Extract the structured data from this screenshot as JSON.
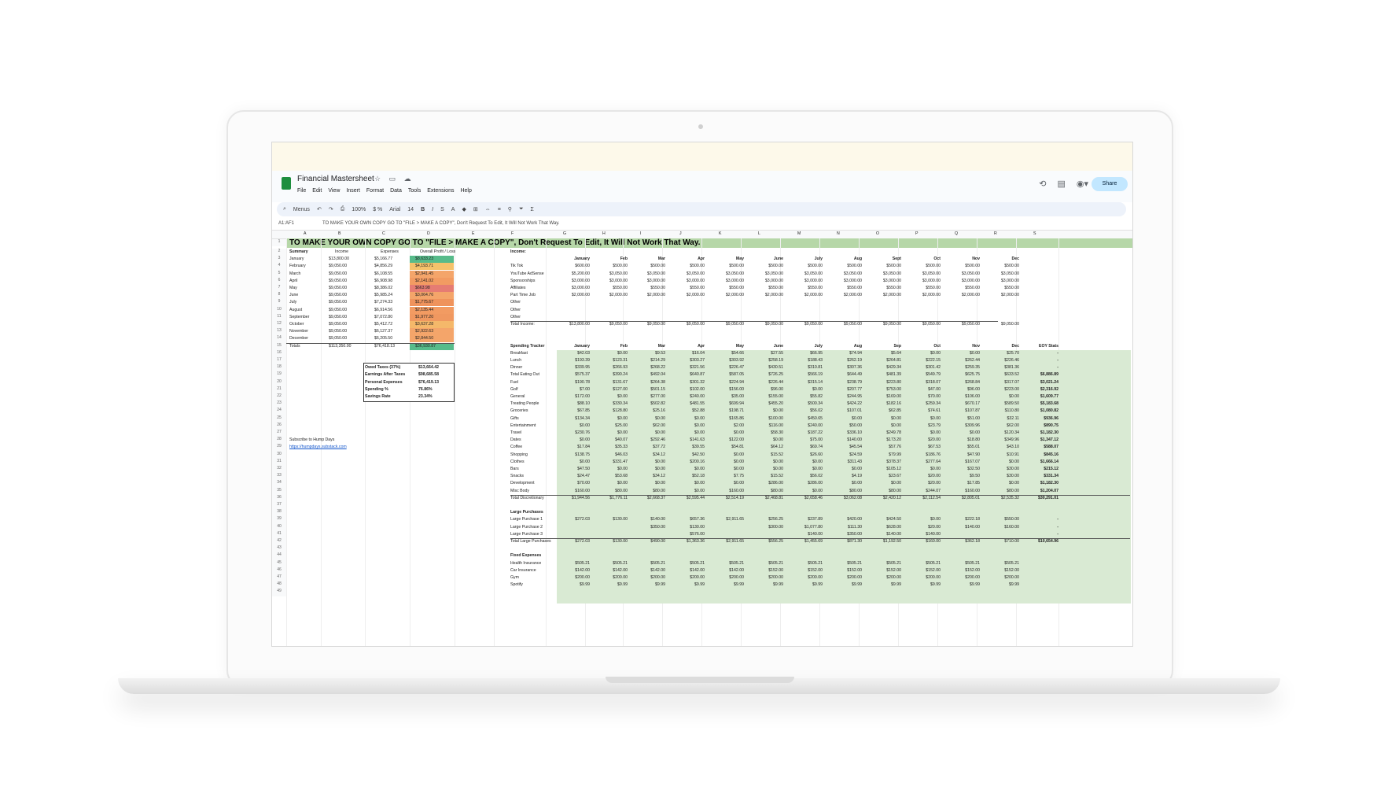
{
  "sheet": {
    "title": "Financial Mastersheet",
    "menu": [
      "File",
      "Edit",
      "View",
      "Insert",
      "Format",
      "Data",
      "Tools",
      "Extensions",
      "Help"
    ],
    "share_label": "Share",
    "toolbar": {
      "menus": "Menus",
      "zoom": "100%",
      "font": "Arial",
      "font_size": "14"
    },
    "namebox": "A1:AF1",
    "formula": "TO MAKE YOUR OWN COPY GO TO \"FILE > MAKE A COPY\", Don't Request To Edit, It Will Not Work That Way.",
    "columns": [
      "A",
      "B",
      "C",
      "D",
      "E",
      "F",
      "G",
      "H",
      "I",
      "J",
      "K",
      "L",
      "M",
      "N",
      "O",
      "P",
      "Q",
      "R",
      "S"
    ],
    "banner": "TO MAKE YOUR OWN COPY GO TO \"FILE > MAKE A COPY\", Don't Request To Edit, It Will Not Work That Way."
  },
  "summary": {
    "headers": [
      "Summary",
      "Income",
      "Expenses",
      "Overall Profit / Loss"
    ],
    "rows": [
      {
        "m": "January",
        "i": "$13,800.00",
        "e": "$5,166.77",
        "p": "$8,633.23",
        "c": "#57bb8a"
      },
      {
        "m": "February",
        "i": "$9,050.00",
        "e": "$4,856.29",
        "p": "$4,193.71",
        "c": "#f5c26b"
      },
      {
        "m": "March",
        "i": "$9,050.00",
        "e": "$6,108.55",
        "p": "$2,941.45",
        "c": "#f4a56a"
      },
      {
        "m": "April",
        "i": "$9,050.00",
        "e": "$6,908.98",
        "p": "$2,141.02",
        "c": "#f29b62"
      },
      {
        "m": "May",
        "i": "$9,050.00",
        "e": "$8,386.02",
        "p": "$663.98",
        "c": "#e67c73"
      },
      {
        "m": "June",
        "i": "$9,050.00",
        "e": "$5,985.24",
        "p": "$3,064.76",
        "c": "#f4a56a"
      },
      {
        "m": "July",
        "i": "$9,050.00",
        "e": "$7,274.33",
        "p": "$1,775.67",
        "c": "#ef935c"
      },
      {
        "m": "August",
        "i": "$9,050.00",
        "e": "$6,914.56",
        "p": "$2,135.44",
        "c": "#f29b62"
      },
      {
        "m": "September",
        "i": "$9,050.00",
        "e": "$7,072.80",
        "p": "$1,977.20",
        "c": "#f09860"
      },
      {
        "m": "October",
        "i": "$9,050.00",
        "e": "$5,412.72",
        "p": "$3,637.28",
        "c": "#f5b86a"
      },
      {
        "m": "November",
        "i": "$9,050.00",
        "e": "$6,127.37",
        "p": "$2,922.63",
        "c": "#f4a56a"
      },
      {
        "m": "December",
        "i": "$9,050.00",
        "e": "$6,205.50",
        "p": "$2,844.50",
        "c": "#f4a56a"
      },
      {
        "m": "Totals",
        "i": "$113,350.00",
        "e": "$76,418.13",
        "p": "$36,930.87",
        "c": "#57bb8a"
      }
    ]
  },
  "stats": [
    {
      "label": "Owed Taxes (37%)",
      "value": "$13,664.42"
    },
    {
      "label": "Earnings After Taxes",
      "value": "$98,685.58"
    },
    {
      "label": "Personal Expenses",
      "value": "$76,419.13"
    },
    {
      "label": "Spending %",
      "value": "76.86%"
    },
    {
      "label": "Savings Rate",
      "value": "23.34%"
    }
  ],
  "subscribe": {
    "text": "Subscribe to Hump Days",
    "link": "https://humpdays.substack.com"
  },
  "income": {
    "title": "Income:",
    "months": [
      "January",
      "Feb",
      "Mar",
      "Apr",
      "May",
      "June",
      "July",
      "Aug",
      "Sept",
      "Oct",
      "Nov",
      "Dec"
    ],
    "rows": [
      {
        "label": "Tik Tok",
        "vals": [
          "$600.00",
          "$500.00",
          "$500.00",
          "$500.00",
          "$500.00",
          "$500.00",
          "$500.00",
          "$500.00",
          "$500.00",
          "$500.00",
          "$500.00",
          "$500.00"
        ]
      },
      {
        "label": "YouTube AdSense",
        "vals": [
          "$5,200.00",
          "$3,050.00",
          "$3,050.00",
          "$3,050.00",
          "$3,050.00",
          "$3,050.00",
          "$3,050.00",
          "$3,050.00",
          "$3,050.00",
          "$3,050.00",
          "$3,050.00",
          "$3,050.00"
        ]
      },
      {
        "label": "Sponsorships",
        "vals": [
          "$3,000.00",
          "$3,000.00",
          "$3,000.00",
          "$3,000.00",
          "$3,000.00",
          "$3,000.00",
          "$3,000.00",
          "$3,000.00",
          "$3,000.00",
          "$3,000.00",
          "$3,000.00",
          "$3,000.00"
        ]
      },
      {
        "label": "Affiliates",
        "vals": [
          "$3,000.00",
          "$550.00",
          "$550.00",
          "$550.00",
          "$550.00",
          "$550.00",
          "$550.00",
          "$550.00",
          "$550.00",
          "$550.00",
          "$550.00",
          "$550.00"
        ]
      },
      {
        "label": "Part Time Job",
        "vals": [
          "$2,000.00",
          "$2,000.00",
          "$2,000.00",
          "$2,000.00",
          "$2,000.00",
          "$2,000.00",
          "$2,000.00",
          "$2,000.00",
          "$2,000.00",
          "$2,000.00",
          "$2,000.00",
          "$2,000.00"
        ]
      },
      {
        "label": "Other",
        "vals": []
      },
      {
        "label": "Other",
        "vals": []
      },
      {
        "label": "Other",
        "vals": []
      }
    ],
    "total_label": "Total Income:",
    "totals": [
      "$13,800.00",
      "$9,050.00",
      "$9,050.00",
      "$9,050.00",
      "$9,050.00",
      "$9,050.00",
      "$9,050.00",
      "$9,050.00",
      "$9,050.00",
      "$9,050.00",
      "$9,050.00",
      "$9,050.00"
    ]
  },
  "spending": {
    "title": "Spending Tracker",
    "months": [
      "January",
      "Feb",
      "Mar",
      "Apr",
      "May",
      "June",
      "July",
      "Aug",
      "Sep",
      "Oct",
      "Nov",
      "Dec",
      "EOY Stats"
    ],
    "rows": [
      {
        "label": "Breakfast",
        "vals": [
          "$42.03",
          "$0.00",
          "$9.53",
          "$16.04",
          "$54.66",
          "$27.55",
          "$66.95",
          "$74.94",
          "$5.64",
          "$0.00",
          "$0.00",
          "$25.70",
          "-"
        ]
      },
      {
        "label": "Lunch",
        "vals": [
          "$193.39",
          "$123.31",
          "$214.29",
          "$303.27",
          "$303.92",
          "$258.19",
          "$188.43",
          "$262.19",
          "$264.81",
          "$222.15",
          "$262.44",
          "$226.46",
          "-"
        ]
      },
      {
        "label": "Dinner",
        "vals": [
          "$339.95",
          "$266.93",
          "$268.22",
          "$321.56",
          "$226.47",
          "$430.51",
          "$310.81",
          "$307.36",
          "$429.34",
          "$301.42",
          "$259.35",
          "$381.36",
          "-"
        ]
      },
      {
        "label": "Total Eating Out",
        "vals": [
          "$575.37",
          "$390.24",
          "$492.04",
          "$640.87",
          "$587.05",
          "$726.25",
          "$566.19",
          "$644.49",
          "$481.39",
          "$549.79",
          "$625.75",
          "$633.52",
          "$6,886.89"
        ]
      },
      {
        "label": "Fuel",
        "vals": [
          "$190.78",
          "$131.67",
          "$264.38",
          "$301.32",
          "$224.94",
          "$226.44",
          "$315.14",
          "$238.79",
          "$223.80",
          "$318.07",
          "$268.84",
          "$317.07",
          "$3,021.24"
        ]
      },
      {
        "label": "Golf",
        "vals": [
          "$7.00",
          "$127.00",
          "$501.15",
          "$102.00",
          "$156.00",
          "$96.00",
          "$0.00",
          "$207.77",
          "$753.00",
          "$47.00",
          "$96.00",
          "$223.00",
          "$2,316.92"
        ]
      },
      {
        "label": "General",
        "vals": [
          "$172.00",
          "$0.00",
          "$277.00",
          "$240.00",
          "$35.00",
          "$155.00",
          "$55.82",
          "$244.95",
          "$169.00",
          "$70.00",
          "$106.00",
          "$0.00",
          "$1,609.77"
        ]
      },
      {
        "label": "Treating People",
        "vals": [
          "$88.10",
          "$330.34",
          "$502.82",
          "$481.55",
          "$699.94",
          "$455.20",
          "$500.34",
          "$424.22",
          "$182.16",
          "$259.34",
          "$670.17",
          "$589.50",
          "$5,183.68"
        ]
      },
      {
        "label": "Groceries",
        "vals": [
          "$67.85",
          "$128.80",
          "$25.16",
          "$52.88",
          "$198.71",
          "$0.00",
          "$56.02",
          "$107.01",
          "$62.85",
          "$74.61",
          "$107.87",
          "$110.80",
          "$1,080.82"
        ]
      },
      {
        "label": "Gifts",
        "vals": [
          "$134.34",
          "$0.00",
          "$0.00",
          "$0.00",
          "$165.86",
          "$100.00",
          "$450.65",
          "$0.00",
          "$0.00",
          "$0.00",
          "$51.00",
          "$32.11",
          "$936.96"
        ]
      },
      {
        "label": "Entertainment",
        "vals": [
          "$0.00",
          "$25.00",
          "$62.00",
          "$0.00",
          "$2.00",
          "$116.00",
          "$240.00",
          "$50.00",
          "$0.00",
          "$23.79",
          "$309.96",
          "$62.00",
          "$890.75"
        ]
      },
      {
        "label": "Travel",
        "vals": [
          "$230.76",
          "$0.00",
          "$0.00",
          "$0.00",
          "$0.00",
          "$58.30",
          "$187.22",
          "$336.10",
          "$249.78",
          "$0.00",
          "$0.00",
          "$120.34",
          "$1,182.30"
        ]
      },
      {
        "label": "Dates",
        "vals": [
          "$0.00",
          "$40.07",
          "$292.46",
          "$141.63",
          "$122.00",
          "$0.00",
          "$75.00",
          "$140.00",
          "$173.20",
          "$20.00",
          "$18.80",
          "$349.96",
          "$1,347.12"
        ]
      },
      {
        "label": "Coffee",
        "vals": [
          "$17.84",
          "$35.33",
          "$37.72",
          "$39.55",
          "$54.81",
          "$64.12",
          "$69.74",
          "$45.54",
          "$57.76",
          "$67.53",
          "$55.01",
          "$43.10",
          "$588.07"
        ]
      },
      {
        "label": "Shopping",
        "vals": [
          "$138.75",
          "$46.03",
          "$34.12",
          "$42.50",
          "$0.00",
          "$15.52",
          "$26.60",
          "$24.59",
          "$79.99",
          "$186.76",
          "$47.90",
          "$10.91",
          "$845.16"
        ]
      },
      {
        "label": "Clothes",
        "vals": [
          "$0.00",
          "$331.47",
          "$0.00",
          "$200.16",
          "$0.00",
          "$0.00",
          "$0.00",
          "$311.43",
          "$378.37",
          "$277.64",
          "$167.07",
          "$0.00",
          "$1,666.14"
        ]
      },
      {
        "label": "Bars",
        "vals": [
          "$47.50",
          "$0.00",
          "$0.00",
          "$0.00",
          "$0.00",
          "$0.00",
          "$0.00",
          "$0.00",
          "$105.12",
          "$0.00",
          "$32.50",
          "$30.00",
          "$215.12"
        ]
      },
      {
        "label": "Snacks",
        "vals": [
          "$24.47",
          "$53.68",
          "$34.12",
          "$52.18",
          "$7.75",
          "$15.52",
          "$56.02",
          "$4.19",
          "$23.67",
          "$20.00",
          "$9.50",
          "$30.00",
          "$331.34"
        ]
      },
      {
        "label": "Development",
        "vals": [
          "$70.00",
          "$0.00",
          "$0.00",
          "$0.00",
          "$0.00",
          "$286.00",
          "$286.00",
          "$0.00",
          "$0.00",
          "$20.00",
          "$17.85",
          "$0.00",
          "$1,182.30"
        ]
      },
      {
        "label": "Misc Body",
        "vals": [
          "$160.00",
          "$80.00",
          "$80.00",
          "$0.00",
          "$160.00",
          "$80.00",
          "$0.00",
          "$80.00",
          "$80.00",
          "$244.07",
          "$160.00",
          "$80.00",
          "$1,204.07"
        ]
      }
    ],
    "total_label": "Total Discretionary",
    "totals": [
      "$1,944.56",
      "$1,776.11",
      "$2,668.37",
      "$2,595.44",
      "$2,514.19",
      "$2,468.81",
      "$2,658.46",
      "$3,062.08",
      "$2,420.12",
      "$2,112.54",
      "$2,805.01",
      "$2,535.32",
      "$30,291.01"
    ]
  },
  "large": {
    "title": "Large Purchases",
    "rows": [
      {
        "label": "Large Purchase 1",
        "vals": [
          "$272.03",
          "$130.00",
          "$140.00",
          "$657.36",
          "$2,911.65",
          "$256.25",
          "$237.89",
          "$420.00",
          "$424.50",
          "$0.00",
          "$222.18",
          "$550.00",
          "-"
        ]
      },
      {
        "label": "Large Purchase 2",
        "vals": [
          "",
          "",
          "$350.00",
          "$130.00",
          "",
          "$300.00",
          "$1,077.80",
          "$111.30",
          "$628.00",
          "$20.00",
          "$140.00",
          "$160.00",
          "-"
        ]
      },
      {
        "label": "Large Purchase 3",
        "vals": [
          "",
          "",
          "",
          "$576.00",
          "",
          "",
          "$140.00",
          "$350.00",
          "$140.00",
          "$140.00",
          "",
          "",
          "-"
        ]
      }
    ],
    "total_label": "Total Large Purchases",
    "totals": [
      "$272.03",
      "$130.00",
      "$490.00",
      "$1,363.36",
      "$2,911.65",
      "$556.25",
      "$1,455.69",
      "$871.30",
      "$1,192.50",
      "$160.00",
      "$362.18",
      "$710.00",
      "$10,654.96"
    ]
  },
  "fixed": {
    "title": "Fixed Expenses",
    "rows": [
      {
        "label": "Health Insurance",
        "vals": [
          "$505.21",
          "$505.21",
          "$505.21",
          "$505.21",
          "$505.21",
          "$505.21",
          "$505.21",
          "$505.21",
          "$505.21",
          "$505.21",
          "$505.21",
          "$505.21",
          ""
        ]
      },
      {
        "label": "Car Insurance",
        "vals": [
          "$142.00",
          "$142.00",
          "$142.00",
          "$142.00",
          "$142.00",
          "$152.00",
          "$152.00",
          "$152.00",
          "$152.00",
          "$152.00",
          "$152.00",
          "$152.00",
          ""
        ]
      },
      {
        "label": "Gym",
        "vals": [
          "$200.00",
          "$200.00",
          "$200.00",
          "$200.00",
          "$200.00",
          "$200.00",
          "$200.00",
          "$200.00",
          "$200.00",
          "$200.00",
          "$200.00",
          "$200.00",
          ""
        ]
      },
      {
        "label": "Spotify",
        "vals": [
          "$9.99",
          "$9.99",
          "$9.99",
          "$9.99",
          "$9.99",
          "$9.99",
          "$9.99",
          "$9.99",
          "$9.99",
          "$9.99",
          "$9.99",
          "$9.99",
          ""
        ]
      }
    ]
  },
  "colors": {
    "banner": "#b6d7a8",
    "green_fill": "#d9ead3",
    "share": "#c2e7ff",
    "sheets_green": "#1e8e3e"
  }
}
